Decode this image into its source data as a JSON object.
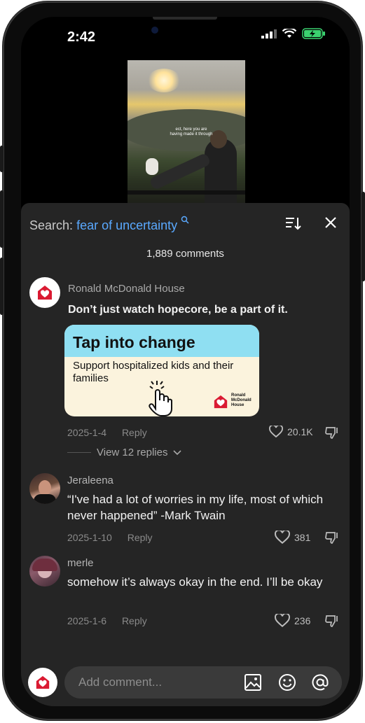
{
  "status": {
    "time": "2:42"
  },
  "video": {
    "caption": "ect, here you are\nhaving made it through"
  },
  "sheet": {
    "search_label": "Search:",
    "search_query": "fear of uncertainty",
    "comment_count": "1,889 comments"
  },
  "comments": [
    {
      "author": "Ronald McDonald House",
      "text": "Don’t just watch hopecore, be a part of it.",
      "date": "2025-1-4",
      "reply": "Reply",
      "likes": "20.1K",
      "ad": {
        "title": "Tap into change",
        "body": "Support hospitalized kids and their families",
        "logo_text": "Ronald McDonald House"
      },
      "view_replies": "View 12 replies"
    },
    {
      "author": "Jeraleena",
      "text": "“I've had a lot of worries in my life, most of which never happened” -Mark Twain",
      "date": "2025-1-10",
      "reply": "Reply",
      "likes": "381"
    },
    {
      "author": "merle",
      "text": "somehow it’s always okay in the end. I’ll be okay",
      "date": "2025-1-6",
      "reply": "Reply",
      "likes": "236"
    }
  ],
  "composer": {
    "placeholder": "Add comment..."
  },
  "colors": {
    "accent": "#5aa9ff",
    "sheet_bg": "#252525",
    "brand_red": "#da1a32"
  },
  "icons": [
    "signal-icon",
    "wifi-icon",
    "battery-icon",
    "search-icon",
    "sort-icon",
    "close-icon",
    "heart-icon",
    "dislike-icon",
    "chevron-down-icon",
    "image-icon",
    "emoji-icon",
    "mention-icon",
    "tap-hand-icon",
    "house-logo-icon"
  ]
}
